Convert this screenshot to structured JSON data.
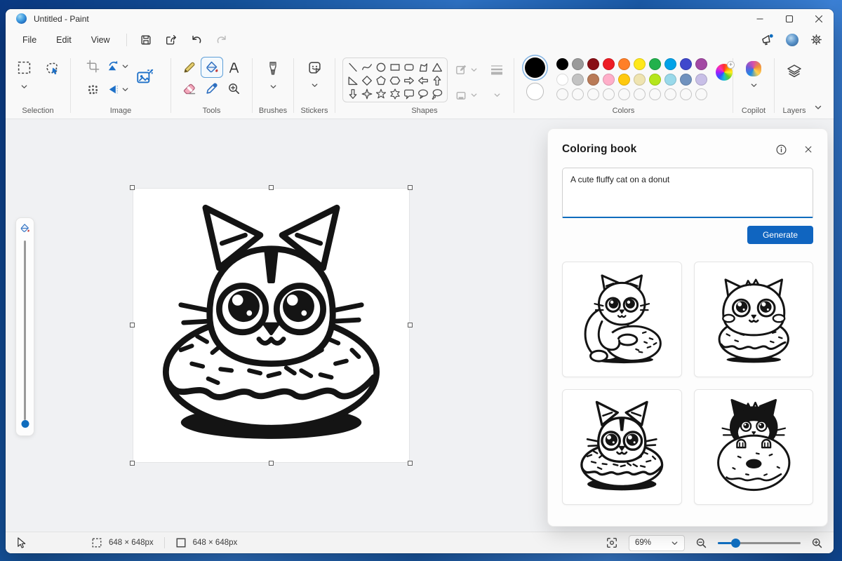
{
  "titlebar": {
    "title": "Untitled - Paint"
  },
  "menu": {
    "items": [
      "File",
      "Edit",
      "View"
    ]
  },
  "ribbon": {
    "labels": {
      "selection": "Selection",
      "image": "Image",
      "tools": "Tools",
      "brushes": "Brushes",
      "stickers": "Stickers",
      "shapes": "Shapes",
      "colors": "Colors",
      "copilot": "Copilot",
      "layers": "Layers"
    },
    "palette": {
      "color1": "#000000",
      "color2": "#ffffff",
      "row1": [
        "#000000",
        "#9a9a9a",
        "#880f15",
        "#ed1c24",
        "#ff7f27",
        "#ffe81a",
        "#22b14c",
        "#00a2e8",
        "#3f48cc",
        "#a349a4"
      ],
      "row2": [
        "#ffffff",
        "#c3c3c3",
        "#b97a57",
        "#ffaec9",
        "#ffc90e",
        "#efe4b0",
        "#b5e61d",
        "#99d9ea",
        "#7092be",
        "#c8bfe7"
      ],
      "empty_slots": 10
    }
  },
  "panel": {
    "title": "Coloring book",
    "prompt": "A cute fluffy cat on a donut",
    "generate_label": "Generate",
    "thumbnails": [
      {
        "name": "cat-hugging-donut",
        "art": "art-hug"
      },
      {
        "name": "chubby-cat-on-donut",
        "art": "art-chubby"
      },
      {
        "name": "cat-inside-donut",
        "art": "art-inside"
      },
      {
        "name": "black-cat-behind-donut",
        "art": "art-black"
      }
    ]
  },
  "canvas": {
    "artref": "#art-inside"
  },
  "statusbar": {
    "selection_size": "648 × 648px",
    "canvas_size": "648 × 648px",
    "zoom": "69%"
  },
  "ui_colors": {
    "accent": "#0f6cbd",
    "generate_button": "#1065c0",
    "selection_ring": "#82b3e3"
  }
}
